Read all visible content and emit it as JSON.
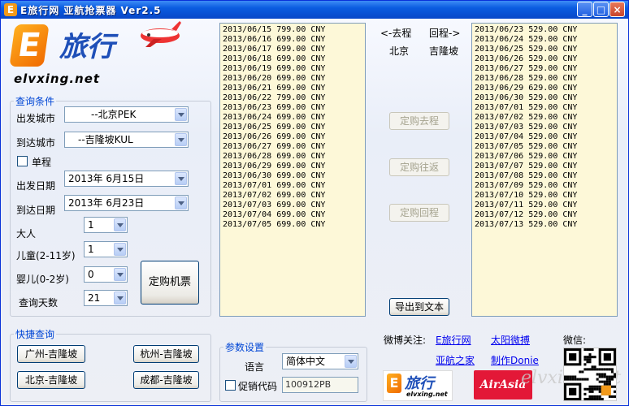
{
  "window": {
    "title": "E旅行网 亚航抢票器 Ver2.5",
    "icon_letter": "E",
    "controls": {
      "minimize": "_",
      "maximize": "□",
      "close": "×"
    }
  },
  "brand": {
    "logo_letter": "E",
    "logo_cn": "旅行",
    "logo_en": "elvxing.net",
    "footer_logo_cn": "旅行",
    "footer_logo_en": "elvxing.net"
  },
  "query": {
    "legend": "查询条件",
    "from_label": "出发城市",
    "from_value": "--北京PEK",
    "to_label": "到达城市",
    "to_value": "--吉隆坡KUL",
    "oneway_label": "单程",
    "depart_label": "出发日期",
    "depart_value": "2013年 6月15日",
    "return_label": "到达日期",
    "return_value": "2013年 6月23日",
    "adult_label": "大人",
    "adult_value": "1",
    "child_label": "儿童(2-11岁)",
    "child_value": "1",
    "infant_label": "婴儿(0-2岁)",
    "infant_value": "0",
    "days_label": "查询天数",
    "days_value": "21",
    "book_button": "定购机票"
  },
  "outbound_list": [
    "2013/06/15 799.00 CNY",
    "2013/06/16 699.00 CNY",
    "2013/06/17 699.00 CNY",
    "2013/06/18 699.00 CNY",
    "2013/06/19 699.00 CNY",
    "2013/06/20 699.00 CNY",
    "2013/06/21 699.00 CNY",
    "2013/06/22 799.00 CNY",
    "2013/06/23 699.00 CNY",
    "2013/06/24 699.00 CNY",
    "2013/06/25 699.00 CNY",
    "2013/06/26 699.00 CNY",
    "2013/06/27 699.00 CNY",
    "2013/06/28 699.00 CNY",
    "2013/06/29 699.00 CNY",
    "2013/06/30 699.00 CNY",
    "2013/07/01 699.00 CNY",
    "2013/07/02 699.00 CNY",
    "2013/07/03 699.00 CNY",
    "2013/07/04 699.00 CNY",
    "2013/07/05 699.00 CNY"
  ],
  "return_list": [
    "2013/06/23 529.00 CNY",
    "2013/06/24 529.00 CNY",
    "2013/06/25 529.00 CNY",
    "2013/06/26 529.00 CNY",
    "2013/06/27 529.00 CNY",
    "2013/06/28 529.00 CNY",
    "2013/06/29 629.00 CNY",
    "2013/06/30 529.00 CNY",
    "2013/07/01 529.00 CNY",
    "2013/07/02 529.00 CNY",
    "2013/07/03 529.00 CNY",
    "2013/07/04 529.00 CNY",
    "2013/07/05 529.00 CNY",
    "2013/07/06 529.00 CNY",
    "2013/07/07 529.00 CNY",
    "2013/07/08 529.00 CNY",
    "2013/07/09 529.00 CNY",
    "2013/07/10 529.00 CNY",
    "2013/07/11 529.00 CNY",
    "2013/07/12 529.00 CNY",
    "2013/07/13 529.00 CNY"
  ],
  "middle": {
    "outbound_header": "<-去程",
    "return_header": "回程->",
    "origin_city": "北京",
    "dest_city": "吉隆坡",
    "book_outbound": "定购去程",
    "book_roundtrip": "定购往返",
    "book_return": "定购回程",
    "export": "导出到文本"
  },
  "quick": {
    "legend": "快捷查询",
    "buttons": [
      "广州-吉隆坡",
      "杭州-吉隆坡",
      "北京-吉隆坡",
      "成都-吉隆坡"
    ]
  },
  "params": {
    "legend": "参数设置",
    "lang_label": "语言",
    "lang_value": "简体中文",
    "promo_label": "促销代码",
    "promo_value": "100912PB"
  },
  "social": {
    "weibo_label": "微博关注:",
    "link1": "E旅行网",
    "link2": "太阳微搏",
    "link3": "亚航之家",
    "link4": "制作Donie",
    "wechat_label": "微信:"
  },
  "footer": {
    "airasia": "AirAsia",
    "watermark": "elvxing.net"
  },
  "colors": {
    "titlebar": "#0a5ce0",
    "list_bg": "#fdf8d8",
    "link": "#0000ee",
    "legend": "#0046d5",
    "airasia": "#e31837"
  }
}
